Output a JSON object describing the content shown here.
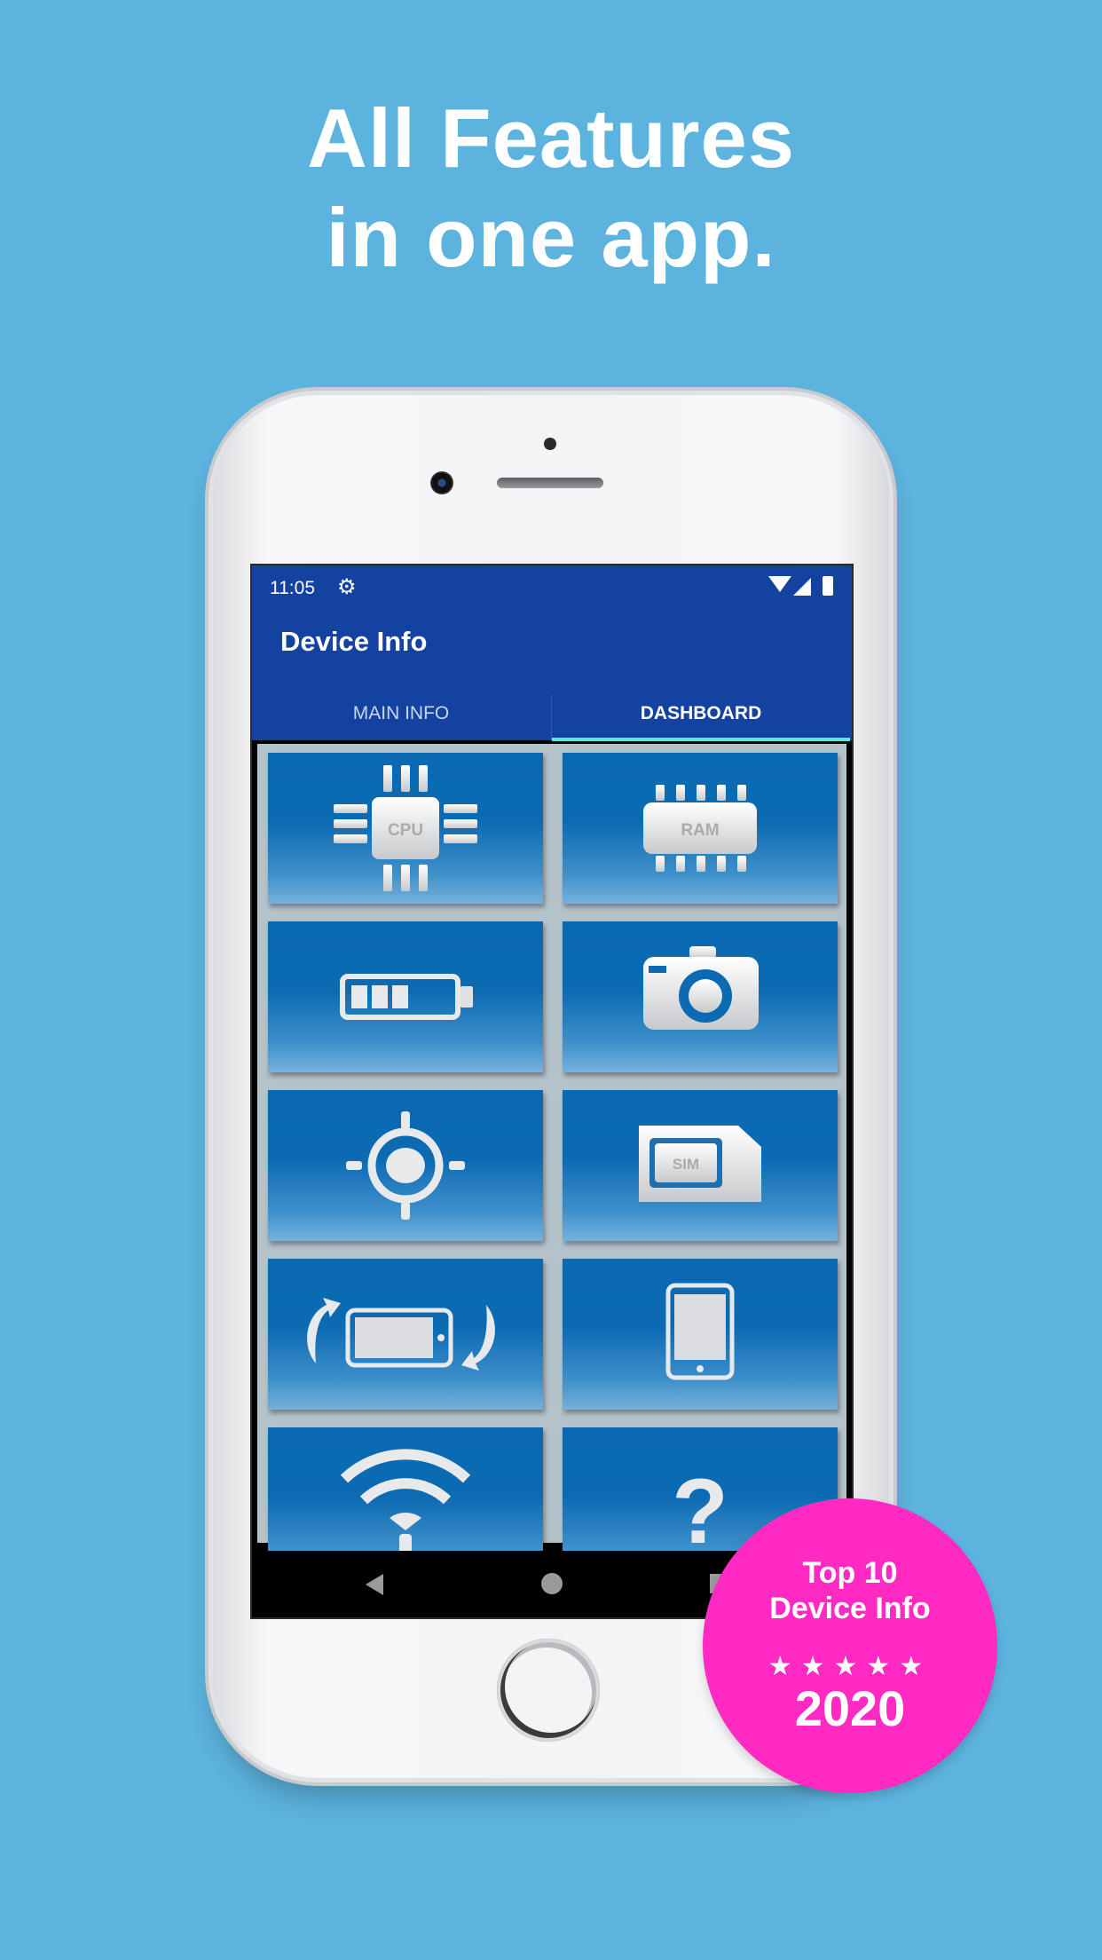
{
  "headline": {
    "line1": "All Features",
    "line2": "in one app."
  },
  "status_bar": {
    "time": "11:05",
    "icons": [
      "gear-icon",
      "wifi-icon",
      "signal-icon",
      "battery-icon"
    ]
  },
  "app": {
    "title": "Device Info",
    "tabs": [
      {
        "label": "MAIN INFO",
        "selected": false
      },
      {
        "label": "DASHBOARD",
        "selected": true
      }
    ],
    "dashboard_tiles": [
      {
        "icon": "cpu-icon",
        "icon_text": "CPU"
      },
      {
        "icon": "ram-icon",
        "icon_text": "RAM"
      },
      {
        "icon": "battery-icon"
      },
      {
        "icon": "camera-icon"
      },
      {
        "icon": "gps-icon"
      },
      {
        "icon": "sim-icon",
        "icon_text": "SIM"
      },
      {
        "icon": "rotation-icon"
      },
      {
        "icon": "phone-icon"
      },
      {
        "icon": "wifi-icon"
      },
      {
        "icon": "question-icon",
        "icon_text": "?"
      }
    ]
  },
  "nav_bar": {
    "icons": [
      "back-icon",
      "home-icon",
      "recents-icon"
    ]
  },
  "badge": {
    "line1": "Top 10",
    "line2": "Device Info",
    "stars": "★★★★★",
    "year": "2020"
  },
  "colors": {
    "background": "#5cb3dd",
    "app_bar": "#1342a0",
    "tab_indicator": "#5ee6e0",
    "tile": "#0969b2",
    "badge": "#ff2ac1"
  }
}
